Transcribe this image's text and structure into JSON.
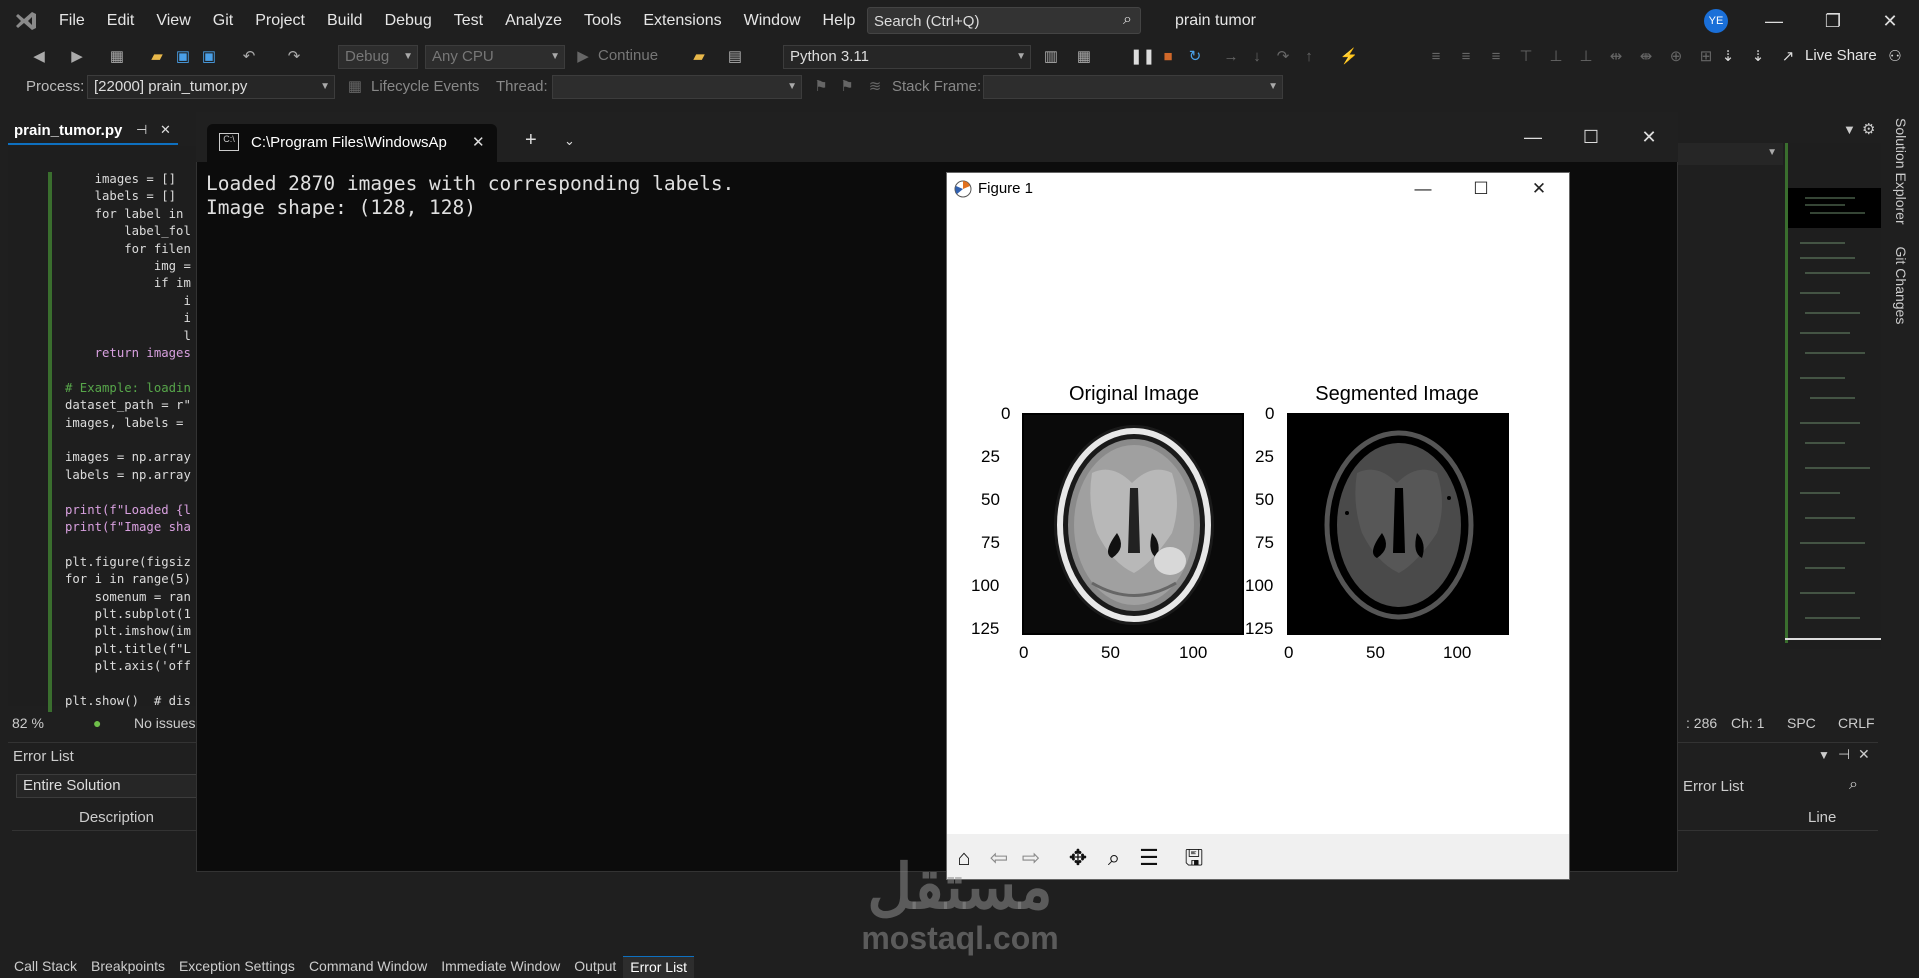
{
  "menu": [
    "File",
    "Edit",
    "View",
    "Git",
    "Project",
    "Build",
    "Debug",
    "Test",
    "Analyze",
    "Tools",
    "Extensions",
    "Window",
    "Help"
  ],
  "search": {
    "placeholder": "Search (Ctrl+Q)"
  },
  "solution_name": "prain tumor",
  "avatar": "YE",
  "toolbar": {
    "config": "Debug",
    "platform": "Any CPU",
    "continue_label": "Continue",
    "python_env": "Python 3.11",
    "live_share": "Live Share"
  },
  "toolbar2": {
    "process_label": "Process:",
    "process_value": "[22000] prain_tumor.py",
    "lifecycle": "Lifecycle Events",
    "thread_label": "Thread:",
    "stack_frame_label": "Stack Frame:"
  },
  "editor": {
    "tab_name": "prain_tumor.py",
    "lines": [
      "    images = []",
      "    labels = []",
      "    for label in ",
      "        label_fol",
      "        for filen",
      "            img =",
      "            if im",
      "                i",
      "                i",
      "                l",
      "    return images",
      "",
      "# Example: loadin",
      "dataset_path = r\"",
      "images, labels = ",
      "",
      "images = np.array",
      "labels = np.array",
      "",
      "print(f\"Loaded {l",
      "print(f\"Image sha",
      "",
      "plt.figure(figsiz",
      "for i in range(5)",
      "    somenum = ran",
      "    plt.subplot(1",
      "    plt.imshow(im",
      "    plt.title(f\"L",
      "    plt.axis('off",
      "",
      "plt.show()  # dis"
    ],
    "zoom": "82 %",
    "issues": "No issues",
    "ln": ": 286",
    "ch": "Ch: 1",
    "spc": "SPC",
    "crlf": "CRLF"
  },
  "error_list": {
    "title": "Error List",
    "scope": "Entire Solution",
    "col_description": "Description",
    "col_line": "Line",
    "search_placeholder": "Error List"
  },
  "bottom_tabs": [
    "Call Stack",
    "Breakpoints",
    "Exception Settings",
    "Command Window",
    "Immediate Window",
    "Output",
    "Error List"
  ],
  "right_vtabs": [
    "Solution Explorer",
    "Git Changes"
  ],
  "terminal": {
    "tab_title": "C:\\Program Files\\WindowsAp",
    "output": [
      "Loaded 2870 images with corresponding labels.",
      "Image shape: (128, 128)"
    ]
  },
  "figure": {
    "title": "Figure 1",
    "plots": [
      {
        "title": "Original Image",
        "yticks": [
          "0",
          "25",
          "50",
          "75",
          "100",
          "125"
        ],
        "xticks": [
          "0",
          "50",
          "100"
        ]
      },
      {
        "title": "Segmented Image",
        "yticks": [
          "0",
          "25",
          "50",
          "75",
          "100",
          "125"
        ],
        "xticks": [
          "0",
          "50",
          "100"
        ]
      }
    ]
  },
  "watermark": {
    "arabic": "مستقل",
    "latin": "mostaql.com"
  }
}
